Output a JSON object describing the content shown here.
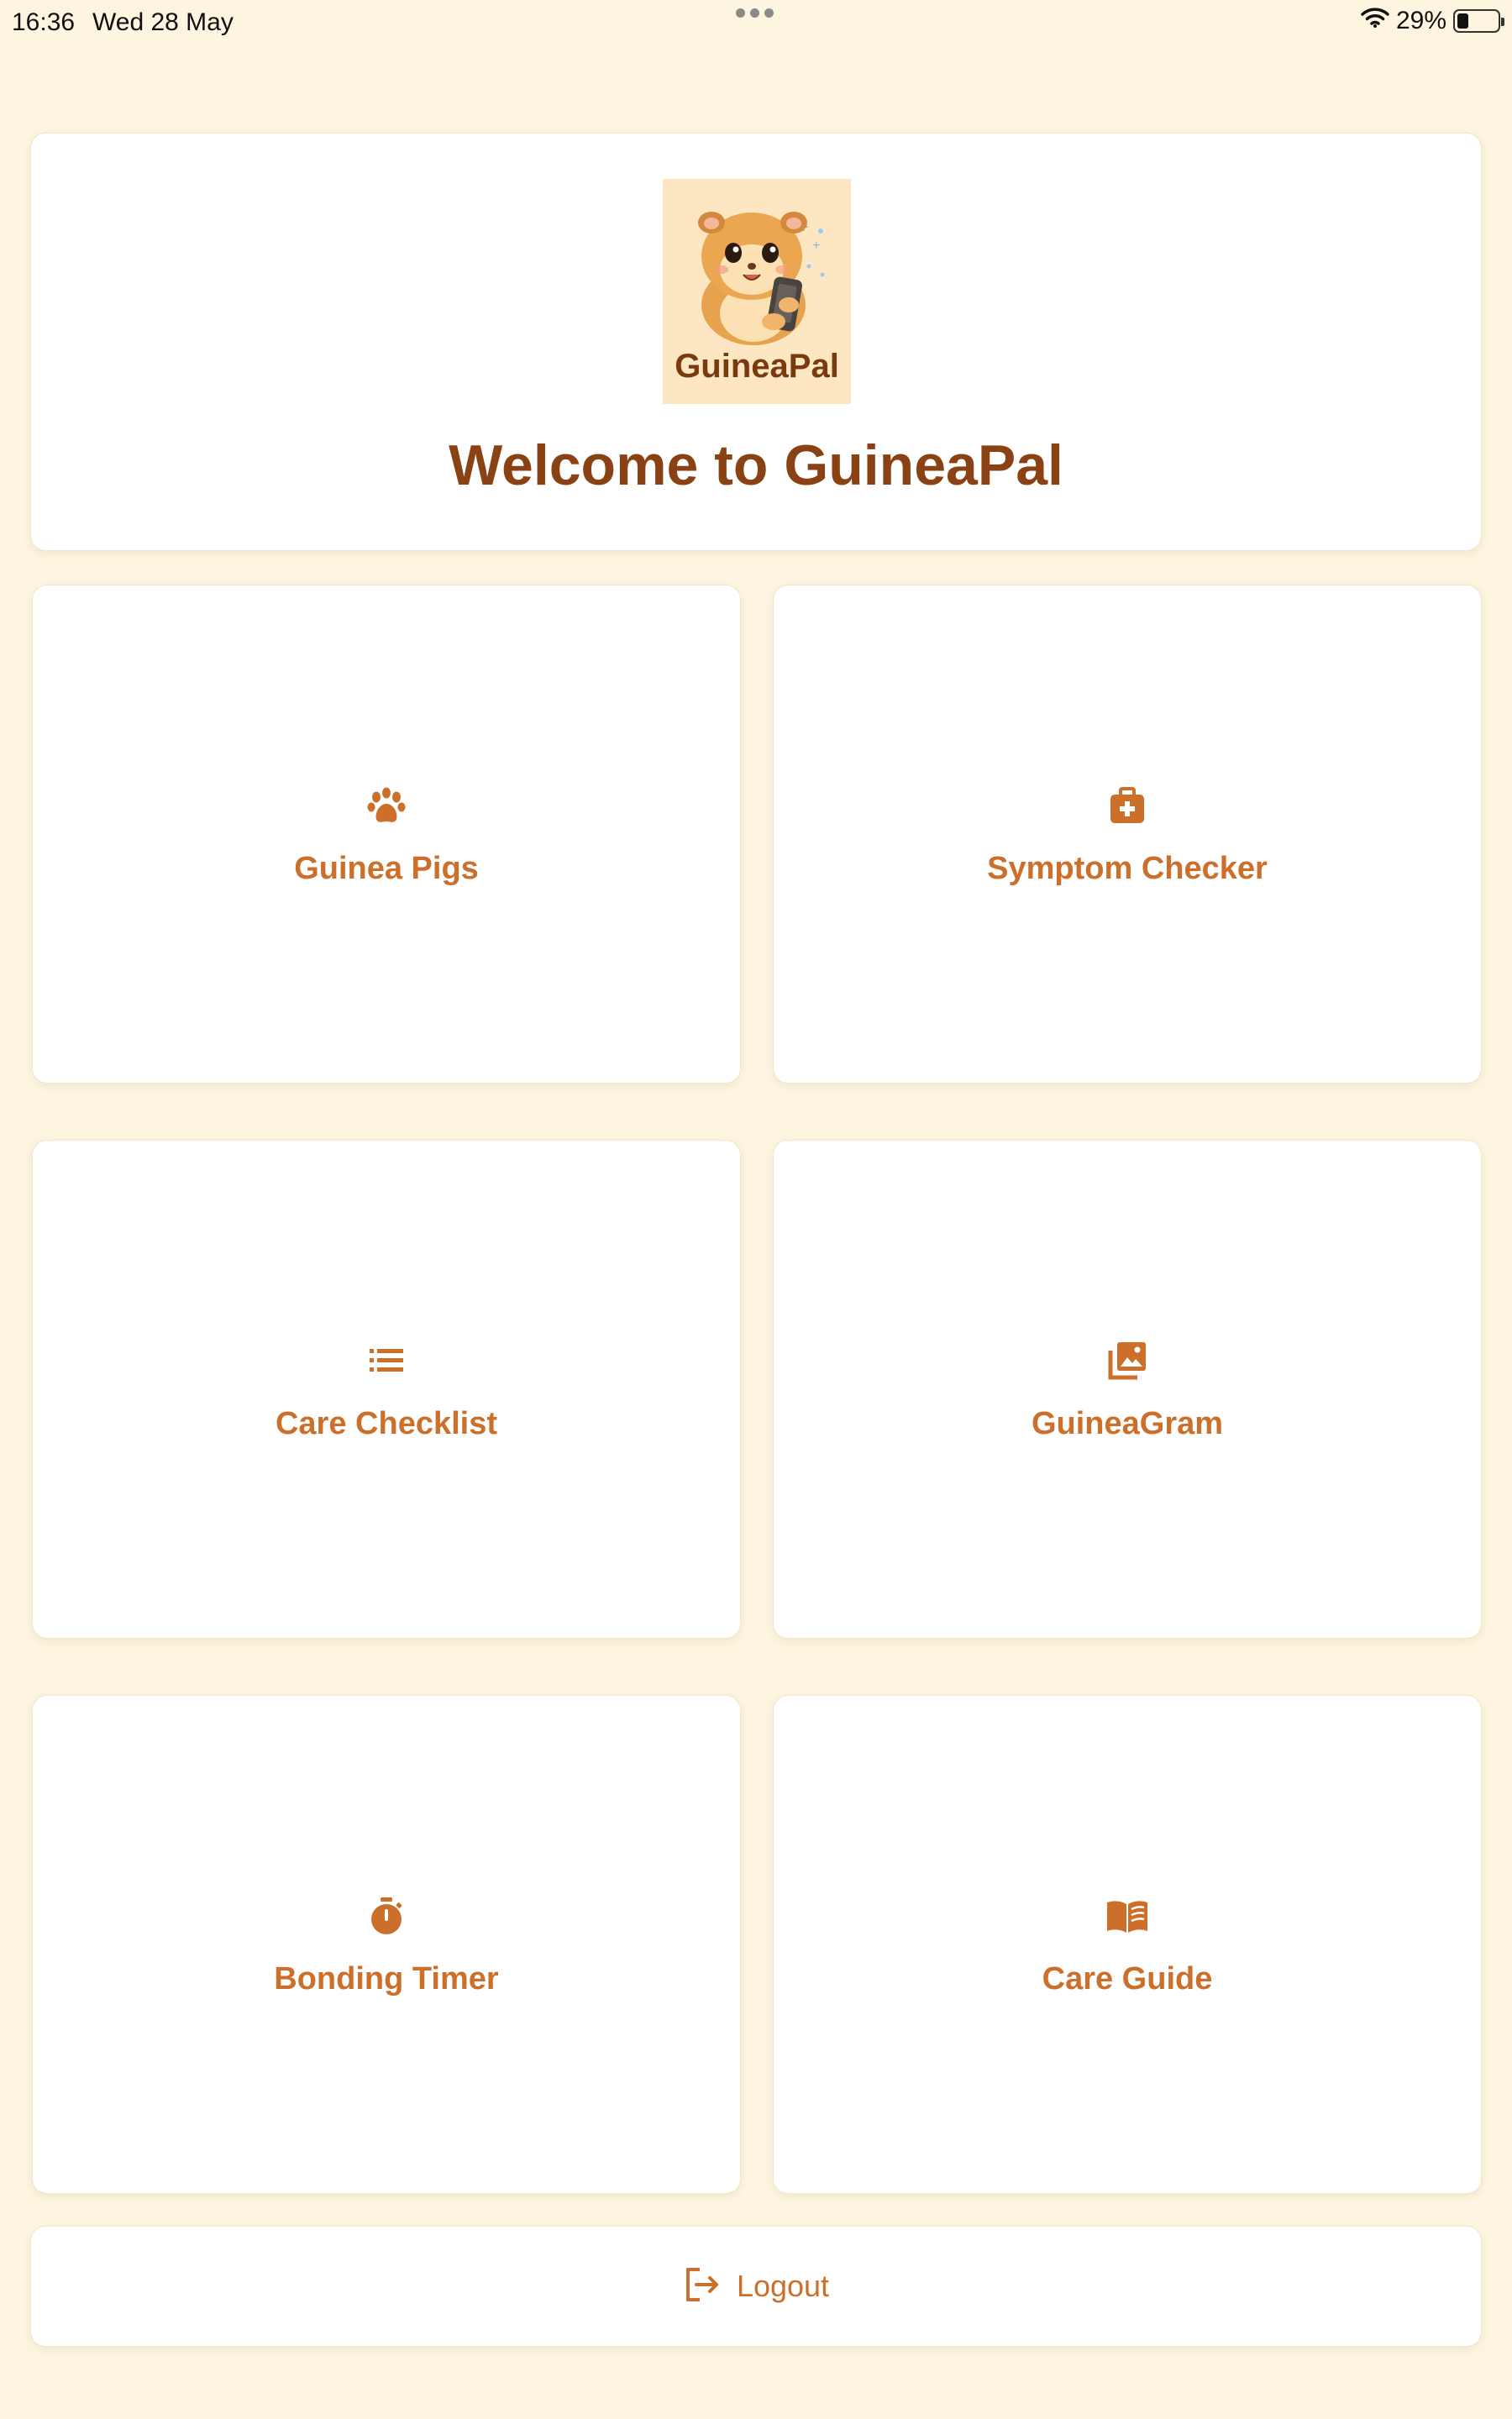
{
  "status_bar": {
    "time": "16:36",
    "date": "Wed 28 May",
    "battery": "29%",
    "battery_level": 0.29
  },
  "header": {
    "logo_text": "GuineaPal",
    "welcome": "Welcome to GuineaPal"
  },
  "tiles": [
    {
      "label": "Guinea Pigs",
      "icon": "paw-icon"
    },
    {
      "label": "Symptom Checker",
      "icon": "medkit-icon"
    },
    {
      "label": "Care Checklist",
      "icon": "list-icon"
    },
    {
      "label": "GuineaGram",
      "icon": "photo-library-icon"
    },
    {
      "label": "Bonding Timer",
      "icon": "stopwatch-icon"
    },
    {
      "label": "Care Guide",
      "icon": "book-icon"
    }
  ],
  "logout": {
    "label": "Logout",
    "icon": "logout-icon"
  },
  "colors": {
    "background": "#fdf5e0",
    "accent": "#cc6f2a",
    "title": "#8a4215"
  }
}
